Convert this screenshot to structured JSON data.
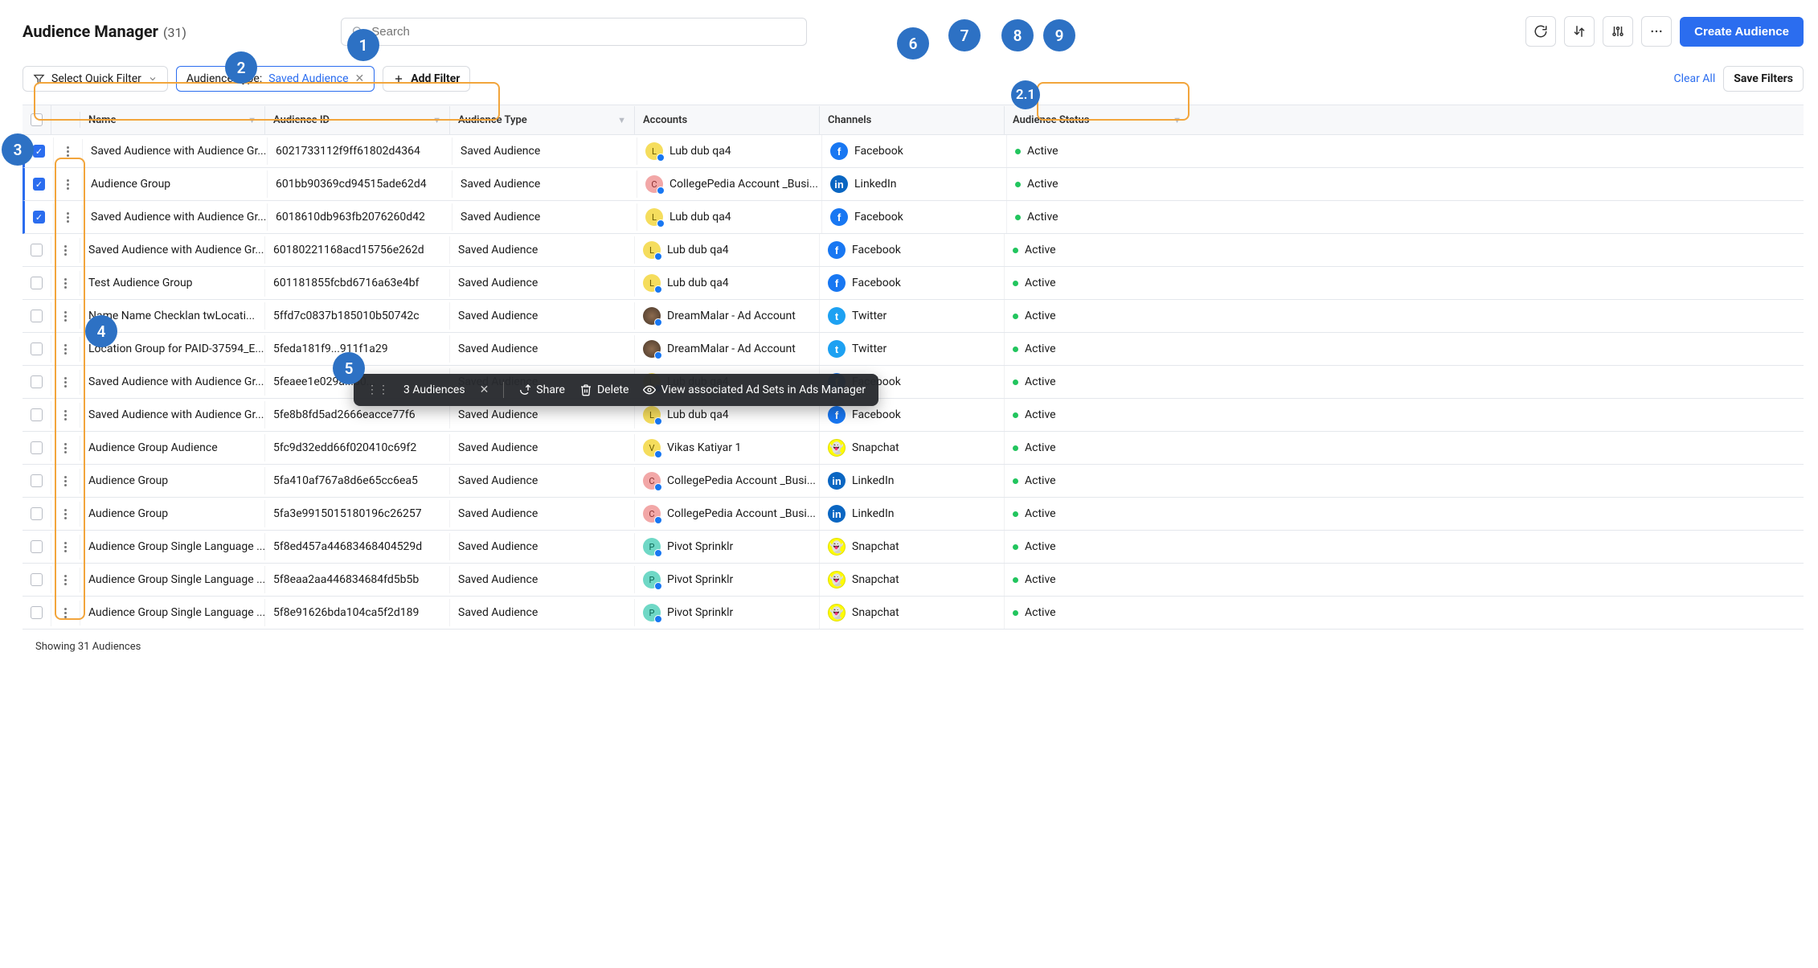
{
  "page_title": "Audience Manager",
  "total_count_display": "(31)",
  "search_placeholder": "Search",
  "create_button": "Create Audience",
  "filter_bar": {
    "quick_filter_label": "Select Quick Filter",
    "chip_label": "Audience Type:",
    "chip_value": "Saved Audience",
    "add_filter": "Add Filter",
    "clear_all": "Clear All",
    "save_filters": "Save Filters"
  },
  "columns": {
    "name": "Name",
    "audience_id": "Audience ID",
    "audience_type": "Audience Type",
    "accounts": "Accounts",
    "channels": "Channels",
    "status": "Audience Status"
  },
  "rows": [
    {
      "sel": true,
      "name": "Saved Audience with Audience Gr...",
      "id": "6021733112f9ff61802d4364",
      "type": "Saved Audience",
      "account": "Lub dub qa4",
      "acct_class": "av-lub",
      "acct_initial": "L",
      "channel": "Facebook",
      "ch_class": "ch-fb",
      "ch_glyph": "f",
      "status": "Active"
    },
    {
      "sel": true,
      "name": "Audience Group",
      "id": "601bb90369cd94515ade62d4",
      "type": "Saved Audience",
      "account": "CollegePedia Account _Busi...",
      "acct_class": "av-col",
      "acct_initial": "C",
      "channel": "LinkedIn",
      "ch_class": "ch-li",
      "ch_glyph": "in",
      "status": "Active"
    },
    {
      "sel": true,
      "name": "Saved Audience with Audience Gr...",
      "id": "6018610db963fb2076260d42",
      "type": "Saved Audience",
      "account": "Lub dub qa4",
      "acct_class": "av-lub",
      "acct_initial": "L",
      "channel": "Facebook",
      "ch_class": "ch-fb",
      "ch_glyph": "f",
      "status": "Active"
    },
    {
      "sel": false,
      "name": "Saved Audience with Audience Gr...",
      "id": "60180221168acd15756e262d",
      "type": "Saved Audience",
      "account": "Lub dub qa4",
      "acct_class": "av-lub",
      "acct_initial": "L",
      "channel": "Facebook",
      "ch_class": "ch-fb",
      "ch_glyph": "f",
      "status": "Active"
    },
    {
      "sel": false,
      "name": "Test Audience Group",
      "id": "601181855fcbd6716a63e4bf",
      "type": "Saved Audience",
      "account": "Lub dub qa4",
      "acct_class": "av-lub",
      "acct_initial": "L",
      "channel": "Facebook",
      "ch_class": "ch-fb",
      "ch_glyph": "f",
      "status": "Active"
    },
    {
      "sel": false,
      "name": "Name Name Checklan twLocati...",
      "id": "5ffd7c0837b185010b50742c",
      "type": "Saved Audience",
      "account": "DreamMalar - Ad Account",
      "acct_class": "av-dream",
      "acct_initial": "",
      "channel": "Twitter",
      "ch_class": "ch-tw",
      "ch_glyph": "t",
      "status": "Active"
    },
    {
      "sel": false,
      "name": "Location Group for PAID-37594_E...",
      "id": "5feda181f9...911f1a29",
      "type": "Saved Audience",
      "account": "DreamMalar - Ad Account",
      "acct_class": "av-dream",
      "acct_initial": "",
      "channel": "Twitter",
      "ch_class": "ch-tw",
      "ch_glyph": "t",
      "status": "Active"
    },
    {
      "sel": false,
      "name": "Saved Audience with Audience Gr...",
      "id": "5feaee1e029a...80...",
      "type": "Saved Audience",
      "account": "Lub dub qa4",
      "acct_class": "av-lub",
      "acct_initial": "L",
      "channel": "Facebook",
      "ch_class": "ch-fb",
      "ch_glyph": "f",
      "status": "Active"
    },
    {
      "sel": false,
      "name": "Saved Audience with Audience Gr...",
      "id": "5fe8b8fd5ad2666eacce77f6",
      "type": "Saved Audience",
      "account": "Lub dub qa4",
      "acct_class": "av-lub",
      "acct_initial": "L",
      "channel": "Facebook",
      "ch_class": "ch-fb",
      "ch_glyph": "f",
      "status": "Active"
    },
    {
      "sel": false,
      "name": "Audience Group Audience",
      "id": "5fc9d32edd66f020410c69f2",
      "type": "Saved Audience",
      "account": "Vikas Katiyar 1",
      "acct_class": "av-vik",
      "acct_initial": "V",
      "channel": "Snapchat",
      "ch_class": "ch-sc",
      "ch_glyph": "👻",
      "status": "Active"
    },
    {
      "sel": false,
      "name": "Audience Group",
      "id": "5fa410af767a8d6e65cc6ea5",
      "type": "Saved Audience",
      "account": "CollegePedia Account _Busi...",
      "acct_class": "av-col",
      "acct_initial": "C",
      "channel": "LinkedIn",
      "ch_class": "ch-li",
      "ch_glyph": "in",
      "status": "Active"
    },
    {
      "sel": false,
      "name": "Audience Group",
      "id": "5fa3e9915015180196c26257",
      "type": "Saved Audience",
      "account": "CollegePedia Account _Busi...",
      "acct_class": "av-col",
      "acct_initial": "C",
      "channel": "LinkedIn",
      "ch_class": "ch-li",
      "ch_glyph": "in",
      "status": "Active"
    },
    {
      "sel": false,
      "name": "Audience Group Single Language ...",
      "id": "5f8ed457a44683468404529d",
      "type": "Saved Audience",
      "account": "Pivot Sprinklr",
      "acct_class": "av-piv",
      "acct_initial": "P",
      "channel": "Snapchat",
      "ch_class": "ch-sc",
      "ch_glyph": "👻",
      "status": "Active"
    },
    {
      "sel": false,
      "name": "Audience Group Single Language ...",
      "id": "5f8eaa2aa446834684fd5b5b",
      "type": "Saved Audience",
      "account": "Pivot Sprinklr",
      "acct_class": "av-piv",
      "acct_initial": "P",
      "channel": "Snapchat",
      "ch_class": "ch-sc",
      "ch_glyph": "👻",
      "status": "Active"
    },
    {
      "sel": false,
      "name": "Audience Group Single Language ...",
      "id": "5f8e91626bda104ca5f2d189",
      "type": "Saved Audience",
      "account": "Pivot Sprinklr",
      "acct_class": "av-piv",
      "acct_initial": "P",
      "channel": "Snapchat",
      "ch_class": "ch-sc",
      "ch_glyph": "👻",
      "status": "Active"
    }
  ],
  "footer_text": "Showing 31 Audiences",
  "float_bar": {
    "count_label": "3 Audiences",
    "share": "Share",
    "delete": "Delete",
    "view": "View associated Ad Sets in Ads Manager"
  },
  "callouts": {
    "c1": "1",
    "c2": "2",
    "c21": "2.1",
    "c3": "3",
    "c4": "4",
    "c5": "5",
    "c6": "6",
    "c7": "7",
    "c8": "8",
    "c9": "9"
  }
}
